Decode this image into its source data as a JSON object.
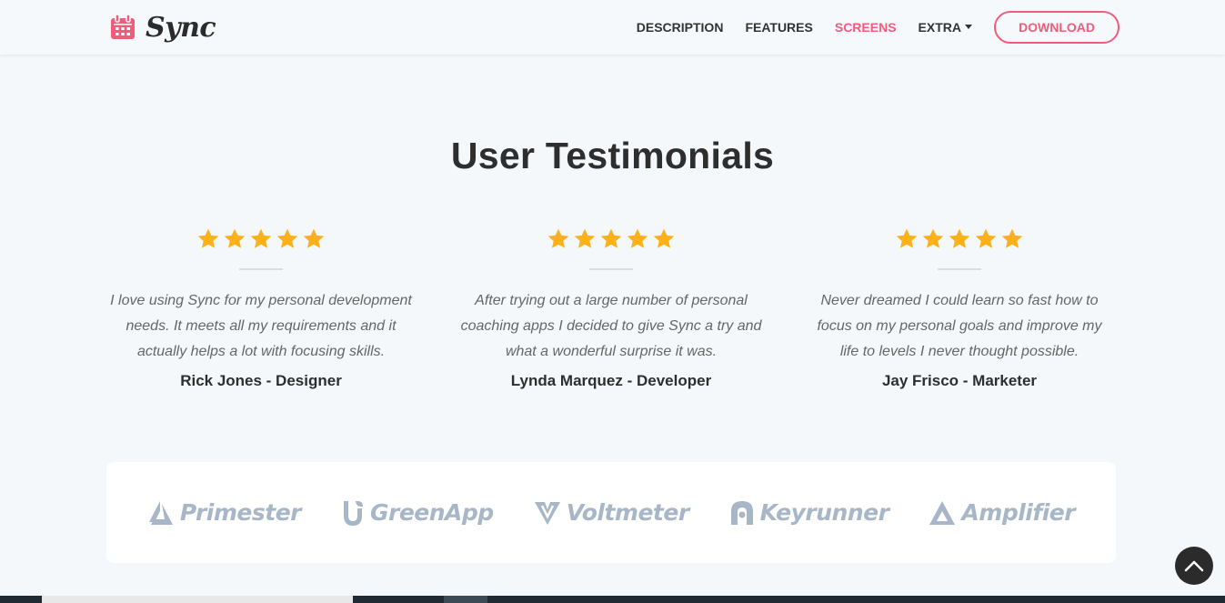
{
  "brand": {
    "name": "Sync",
    "accent_color": "#f25c7a",
    "icon": "calendar-icon"
  },
  "nav": {
    "items": [
      {
        "label": "DESCRIPTION",
        "active": false
      },
      {
        "label": "FEATURES",
        "active": false
      },
      {
        "label": "SCREENS",
        "active": true
      },
      {
        "label": "EXTRA",
        "active": false,
        "dropdown": true
      }
    ],
    "download_label": "DOWNLOAD"
  },
  "section": {
    "title": "User Testimonials"
  },
  "testimonials": [
    {
      "rating": 5,
      "quote": "I love using Sync for my personal development needs. It meets all my requirements and it actually helps a lot with focusing skills.",
      "author": "Rick Jones - Designer"
    },
    {
      "rating": 5,
      "quote": "After trying out a large number of personal coaching apps I decided to give Sync a try and what a wonderful surprise it was.",
      "author": "Lynda Marquez - Developer"
    },
    {
      "rating": 5,
      "quote": "Never dreamed I could learn so fast how to focus on my personal goals and improve my life to levels I never thought possible.",
      "author": "Jay Frisco - Marketer"
    }
  ],
  "star_color": "#fbb117",
  "partners": [
    {
      "name": "Primester",
      "icon": "primester-logo-icon"
    },
    {
      "name": "GreenApp",
      "icon": "greenapp-logo-icon"
    },
    {
      "name": "Voltmeter",
      "icon": "voltmeter-logo-icon"
    },
    {
      "name": "Keyrunner",
      "icon": "keyrunner-logo-icon"
    },
    {
      "name": "Amplifier",
      "icon": "amplifier-logo-icon"
    }
  ],
  "back_to_top_icon": "chevron-up-icon"
}
